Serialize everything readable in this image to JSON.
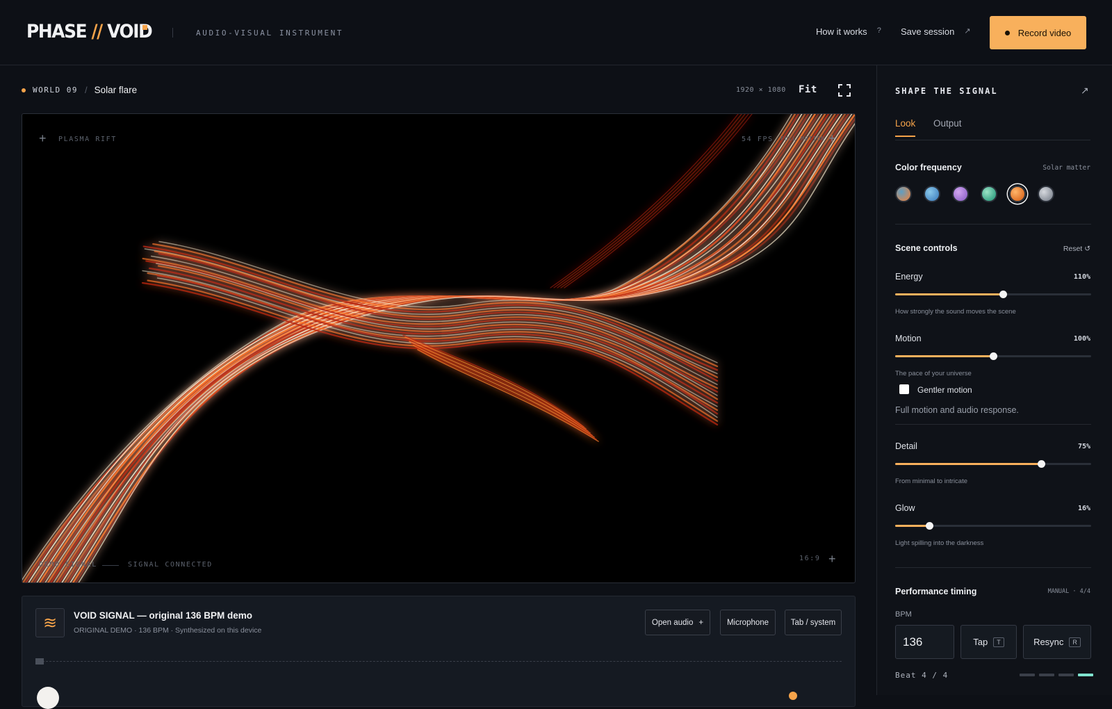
{
  "header": {
    "logo": {
      "part1": "PHASE ",
      "slash": "//",
      "part2": " VOID"
    },
    "tagline": "AUDIO-VISUAL INSTRUMENT",
    "how_it_works": "How it works",
    "how_icon": "?",
    "save_session": "Save session",
    "save_icon": "↗",
    "record_video": "Record video"
  },
  "breadcrumb": {
    "world": "WORLD 09",
    "separator": "/",
    "scene": "Solar flare"
  },
  "stage_toolbar": {
    "resolution": "1920 × 1080",
    "fit": "Fit"
  },
  "stage": {
    "top_left_label": "PLASMA RIFT",
    "fps": "54 FPS",
    "motion_mode": "FULL MOTION",
    "bottom_left_1": "DEMO SIGNAL",
    "bottom_left_2": "SIGNAL CONNECTED",
    "aspect": "16:9",
    "palette": {
      "core": "#fff3d6",
      "mid": "#ff7a2a",
      "outer": "#b8230e"
    }
  },
  "audio": {
    "icon": "≋",
    "title": "VOID SIGNAL — original 136 BPM demo",
    "subtitle": "ORIGINAL DEMO · 136 BPM · Synthesized on this device",
    "open_audio": "Open audio",
    "open_audio_icon": "+",
    "microphone": "Microphone",
    "tab_system": "Tab / system"
  },
  "panel": {
    "title": "SHAPE THE SIGNAL",
    "popout_icon": "↗",
    "tabs": [
      {
        "label": "Look",
        "active": true
      },
      {
        "label": "Output",
        "active": false
      }
    ],
    "color_frequency": {
      "label": "Color frequency",
      "selected_name": "Solar matter",
      "swatches": [
        {
          "color": "#c98a5f",
          "accent": "#5e9ec4"
        },
        {
          "color": "#4f8fc8",
          "accent": "#8ac8ea"
        },
        {
          "color": "#9b6fd0",
          "accent": "#d2a6f0"
        },
        {
          "color": "#3fa88a",
          "accent": "#9be3c6"
        },
        {
          "color": "#e0742a",
          "accent": "#ffb56a",
          "selected": true
        },
        {
          "color": "#8e949e",
          "accent": "#d6d9de"
        }
      ]
    },
    "scene_controls": {
      "label": "Scene controls",
      "reset": "Reset ↺",
      "energy": {
        "label": "Energy",
        "value": "110%",
        "fraction": 0.55,
        "hint": "How strongly the sound moves the scene"
      },
      "motion": {
        "label": "Motion",
        "value": "100%",
        "fraction": 0.5,
        "hint": "The pace of your universe"
      },
      "gentler_motion": "Gentler motion",
      "motion_note": "Full motion and audio response.",
      "detail": {
        "label": "Detail",
        "value": "75%",
        "fraction": 0.745,
        "hint": "From minimal to intricate"
      },
      "glow": {
        "label": "Glow",
        "value": "16%",
        "fraction": 0.175,
        "hint": "Light spilling into the darkness"
      }
    },
    "timing": {
      "label": "Performance timing",
      "mode": "MANUAL · 4/4",
      "bpm_label": "BPM",
      "bpm_value": "136",
      "tap": "Tap",
      "tap_key": "T",
      "resync": "Resync",
      "resync_key": "R",
      "beat": "Beat 4 / 4",
      "beat_current": 4
    }
  }
}
